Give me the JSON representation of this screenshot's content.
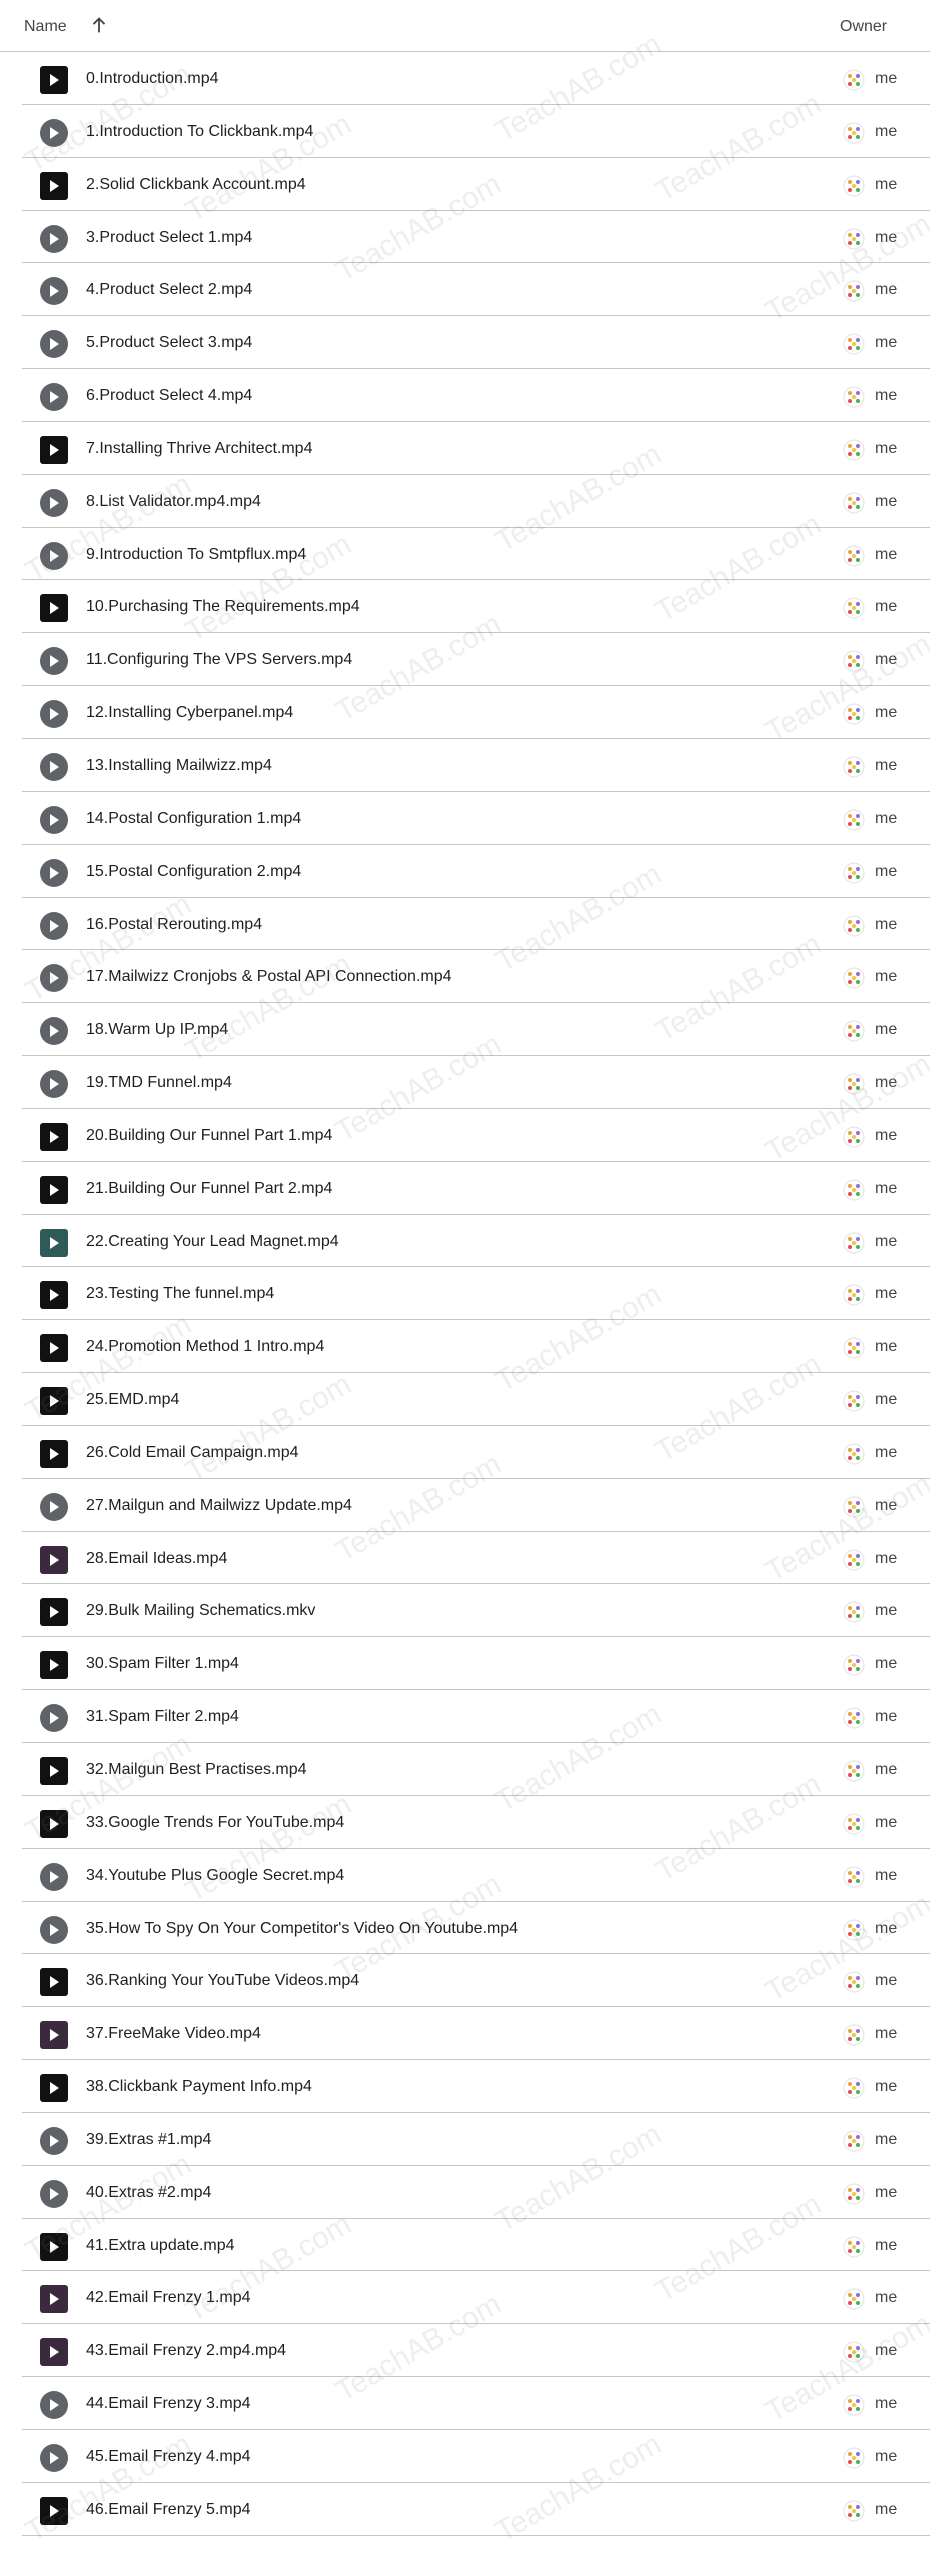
{
  "header": {
    "name_label": "Name",
    "owner_label": "Owner",
    "sort_icon": "arrow-up-icon"
  },
  "files": [
    {
      "name": "0.Introduction.mp4",
      "thumb": "dark",
      "owner": "me"
    },
    {
      "name": "1.Introduction To Clickbank.mp4",
      "thumb": "circle",
      "owner": "me"
    },
    {
      "name": "2.Solid Clickbank Account.mp4",
      "thumb": "dark",
      "owner": "me"
    },
    {
      "name": "3.Product Select 1.mp4",
      "thumb": "circle",
      "owner": "me"
    },
    {
      "name": "4.Product Select 2.mp4",
      "thumb": "circle",
      "owner": "me"
    },
    {
      "name": "5.Product Select 3.mp4",
      "thumb": "circle",
      "owner": "me"
    },
    {
      "name": "6.Product Select 4.mp4",
      "thumb": "circle",
      "owner": "me"
    },
    {
      "name": "7.Installing Thrive Architect.mp4",
      "thumb": "dark",
      "owner": "me"
    },
    {
      "name": "8.List Validator.mp4.mp4",
      "thumb": "circle",
      "owner": "me"
    },
    {
      "name": "9.Introduction To Smtpflux.mp4",
      "thumb": "circle",
      "owner": "me"
    },
    {
      "name": "10.Purchasing The Requirements.mp4",
      "thumb": "dark",
      "owner": "me"
    },
    {
      "name": "11.Configuring The VPS Servers.mp4",
      "thumb": "circle",
      "owner": "me"
    },
    {
      "name": "12.Installing Cyberpanel.mp4",
      "thumb": "circle",
      "owner": "me"
    },
    {
      "name": "13.Installing Mailwizz.mp4",
      "thumb": "circle",
      "owner": "me"
    },
    {
      "name": "14.Postal Configuration 1.mp4",
      "thumb": "circle",
      "owner": "me"
    },
    {
      "name": "15.Postal Configuration 2.mp4",
      "thumb": "circle",
      "owner": "me"
    },
    {
      "name": "16.Postal Rerouting.mp4",
      "thumb": "circle",
      "owner": "me"
    },
    {
      "name": "17.Mailwizz Cronjobs & Postal API Connection.mp4",
      "thumb": "circle",
      "owner": "me"
    },
    {
      "name": "18.Warm Up IP.mp4",
      "thumb": "circle",
      "owner": "me"
    },
    {
      "name": "19.TMD Funnel.mp4",
      "thumb": "circle",
      "owner": "me"
    },
    {
      "name": "20.Building Our Funnel Part 1.mp4",
      "thumb": "dark",
      "owner": "me"
    },
    {
      "name": "21.Building Our Funnel Part 2.mp4",
      "thumb": "dark",
      "owner": "me"
    },
    {
      "name": "22.Creating Your Lead Magnet.mp4",
      "thumb": "teal",
      "owner": "me"
    },
    {
      "name": "23.Testing The funnel.mp4",
      "thumb": "dark",
      "owner": "me"
    },
    {
      "name": "24.Promotion Method 1 Intro.mp4",
      "thumb": "dark",
      "owner": "me"
    },
    {
      "name": "25.EMD.mp4",
      "thumb": "dark",
      "owner": "me"
    },
    {
      "name": "26.Cold Email Campaign.mp4",
      "thumb": "dark",
      "owner": "me"
    },
    {
      "name": "27.Mailgun and Mailwizz Update.mp4",
      "thumb": "circle",
      "owner": "me"
    },
    {
      "name": "28.Email Ideas.mp4",
      "thumb": "purple",
      "owner": "me"
    },
    {
      "name": "29.Bulk Mailing Schematics.mkv",
      "thumb": "dark",
      "owner": "me"
    },
    {
      "name": "30.Spam Filter 1.mp4",
      "thumb": "dark",
      "owner": "me"
    },
    {
      "name": "31.Spam Filter 2.mp4",
      "thumb": "circle",
      "owner": "me"
    },
    {
      "name": "32.Mailgun Best Practises.mp4",
      "thumb": "dark",
      "owner": "me"
    },
    {
      "name": "33.Google Trends For YouTube.mp4",
      "thumb": "dark",
      "owner": "me"
    },
    {
      "name": "34.Youtube Plus Google Secret.mp4",
      "thumb": "circle",
      "owner": "me"
    },
    {
      "name": "35.How To Spy On Your Competitor's Video On Youtube.mp4",
      "thumb": "circle",
      "owner": "me"
    },
    {
      "name": "36.Ranking Your YouTube Videos.mp4",
      "thumb": "dark",
      "owner": "me"
    },
    {
      "name": "37.FreeMake Video.mp4",
      "thumb": "purple",
      "owner": "me"
    },
    {
      "name": "38.Clickbank Payment Info.mp4",
      "thumb": "dark",
      "owner": "me"
    },
    {
      "name": "39.Extras #1.mp4",
      "thumb": "circle",
      "owner": "me"
    },
    {
      "name": "40.Extras #2.mp4",
      "thumb": "circle",
      "owner": "me"
    },
    {
      "name": "41.Extra update.mp4",
      "thumb": "dark",
      "owner": "me"
    },
    {
      "name": "42.Email Frenzy 1.mp4",
      "thumb": "purple",
      "owner": "me"
    },
    {
      "name": "43.Email Frenzy 2.mp4.mp4",
      "thumb": "purple",
      "owner": "me"
    },
    {
      "name": "44.Email Frenzy 3.mp4",
      "thumb": "circle",
      "owner": "me"
    },
    {
      "name": "45.Email Frenzy 4.mp4",
      "thumb": "circle",
      "owner": "me"
    },
    {
      "name": "46.Email Frenzy 5.mp4",
      "thumb": "dark",
      "owner": "me"
    }
  ],
  "watermark": "TeachAB.com",
  "colors": {
    "divider": "#c4c7c5",
    "circle_thumb": "#5f6368",
    "dark_thumb": "#111111"
  }
}
